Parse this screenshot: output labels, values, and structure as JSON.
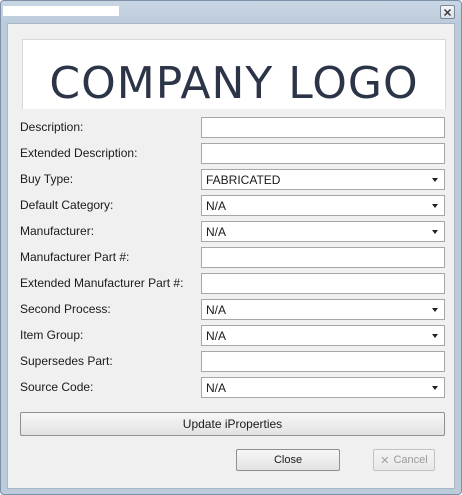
{
  "window": {
    "close_icon": "close-icon"
  },
  "logo": {
    "text": "COMPANY LOGO"
  },
  "form": {
    "description": {
      "label": "Description:",
      "value": ""
    },
    "extended_description": {
      "label": "Extended Description:",
      "value": ""
    },
    "buy_type": {
      "label": "Buy Type:",
      "value": "FABRICATED"
    },
    "default_category": {
      "label": "Default Category:",
      "value": "N/A"
    },
    "manufacturer": {
      "label": "Manufacturer:",
      "value": "N/A"
    },
    "manufacturer_part": {
      "label": "Manufacturer Part #:",
      "value": ""
    },
    "extended_manufacturer_part": {
      "label": "Extended Manufacturer Part #:",
      "value": ""
    },
    "second_process": {
      "label": "Second Process:",
      "value": "N/A"
    },
    "item_group": {
      "label": "Item Group:",
      "value": "N/A"
    },
    "supersedes_part": {
      "label": "Supersedes Part:",
      "value": ""
    },
    "source_code": {
      "label": "Source Code:",
      "value": "N/A"
    }
  },
  "buttons": {
    "update": "Update iProperties",
    "close": "Close",
    "cancel": "Cancel"
  },
  "icons": {
    "cancel": "x-icon",
    "dropdown": "chevron-down-icon"
  },
  "colors": {
    "logo_text": "#2c3547",
    "window_frame": "#bccbdc",
    "panel": "#f0f0f0"
  }
}
